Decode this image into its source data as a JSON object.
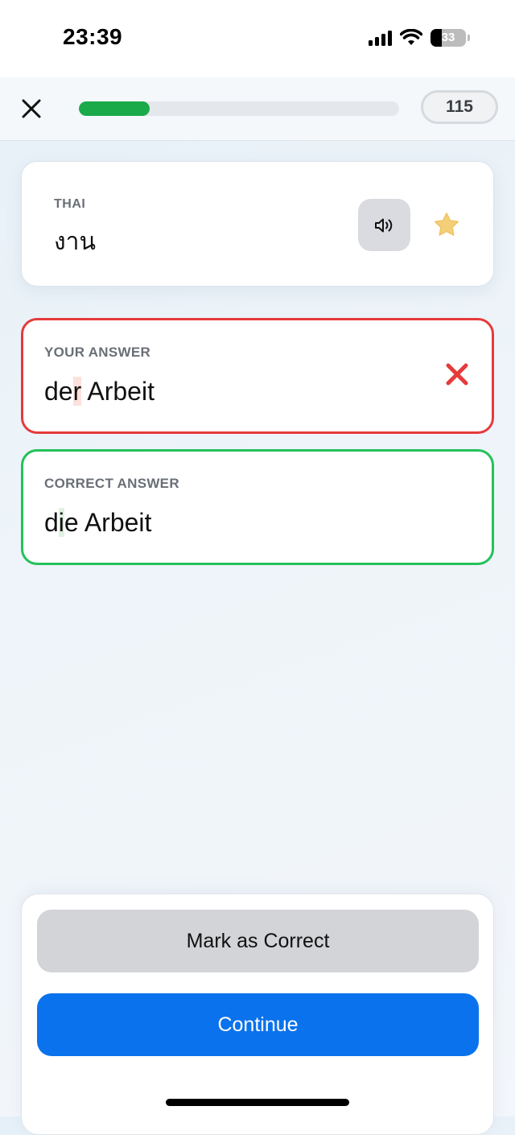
{
  "status_bar": {
    "time": "23:39",
    "battery": "33"
  },
  "top_bar": {
    "progress_fraction": 0.22,
    "count": "115",
    "progress_color": "#1aaa4a"
  },
  "prompt": {
    "language_label": "THAI",
    "word": "งาน"
  },
  "your_answer": {
    "label": "YOUR ANSWER",
    "highlight": "r",
    "prefix": "de",
    "rest": " Arbeit",
    "status": "wrong",
    "border_color": "#e53b3b"
  },
  "correct_answer": {
    "label": "CORRECT ANSWER",
    "prefix": "d",
    "highlight": "i",
    "rest": "e Arbeit",
    "border_color": "#24c15a"
  },
  "buttons": {
    "mark_correct": "Mark as Correct",
    "continue": "Continue",
    "continue_color": "#0a72ec"
  },
  "icons": [
    "close-icon",
    "speaker-icon",
    "star-icon",
    "wrong-x-icon",
    "signal-icon",
    "wifi-icon",
    "battery-icon"
  ]
}
